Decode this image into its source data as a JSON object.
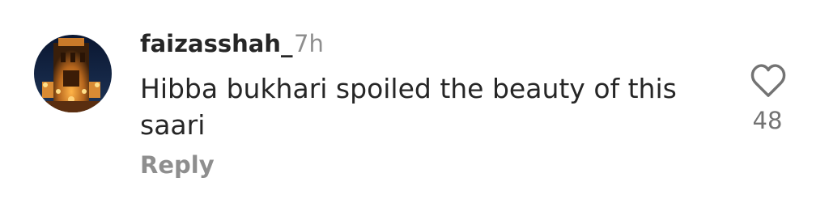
{
  "comment": {
    "username": "faizasshah_",
    "timestamp": "7h",
    "text": "Hibba bukhari spoiled the beauty of this saari",
    "reply_label": "Reply",
    "like_count": "48",
    "like_icon": "heart-outline-icon"
  }
}
